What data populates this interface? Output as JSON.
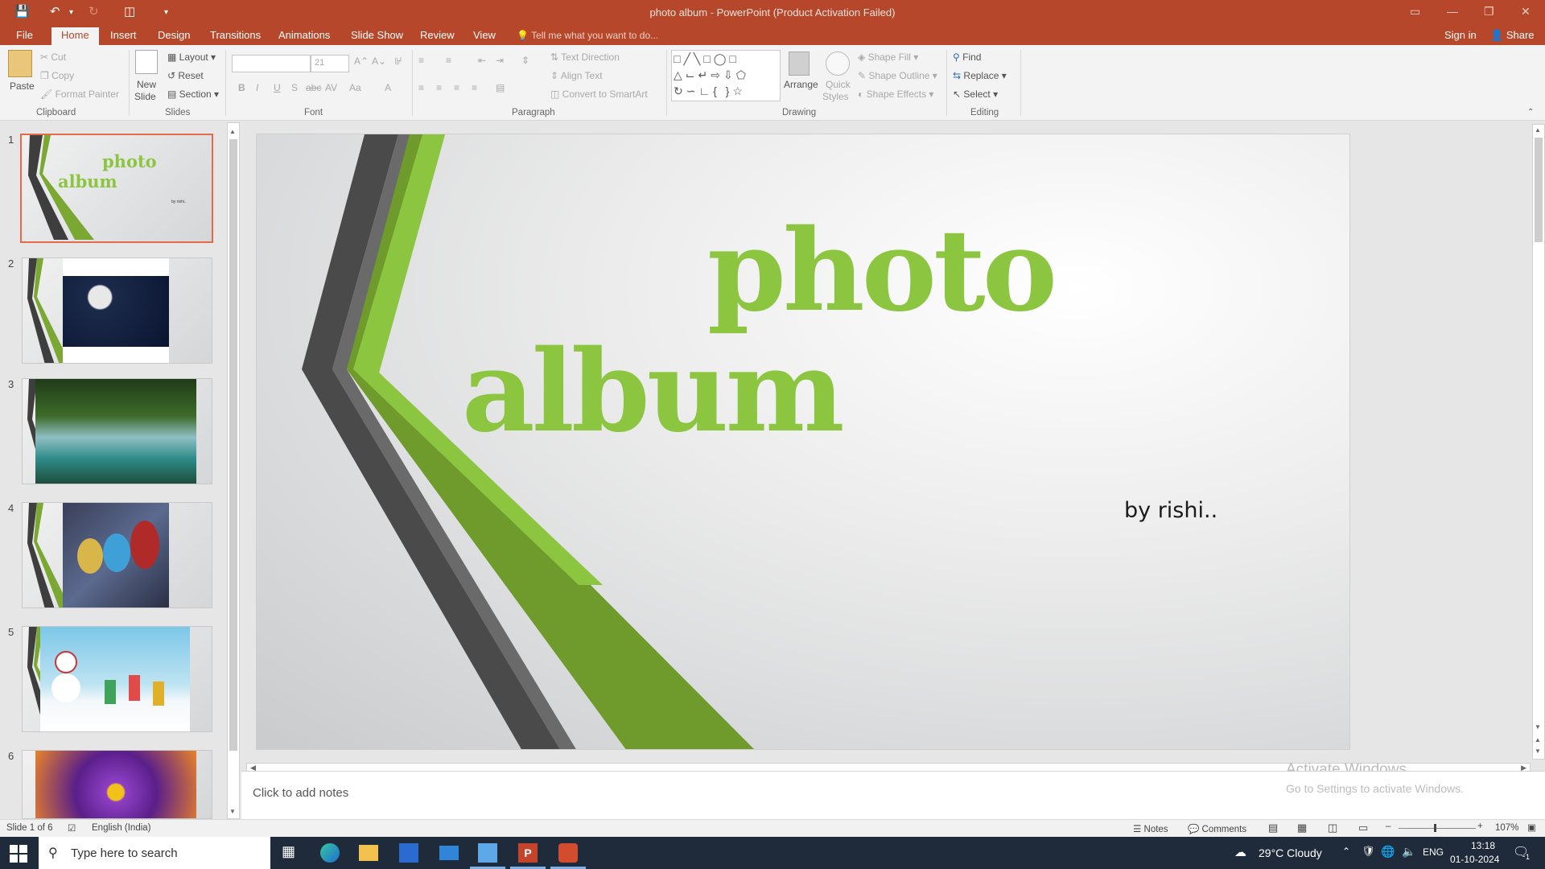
{
  "window": {
    "title": "photo album - PowerPoint (Product Activation Failed)"
  },
  "tabs": [
    "File",
    "Home",
    "Insert",
    "Design",
    "Transitions",
    "Animations",
    "Slide Show",
    "Review",
    "View"
  ],
  "tellme": "Tell me what you want to do...",
  "signin": "Sign in",
  "share": "Share",
  "ribbon": {
    "clipboard": {
      "paste": "Paste",
      "cut": "Cut",
      "copy": "Copy",
      "format_painter": "Format Painter",
      "label": "Clipboard"
    },
    "slides": {
      "new_slide_1": "New",
      "new_slide_2": "Slide",
      "layout": "Layout",
      "reset": "Reset",
      "section": "Section",
      "label": "Slides"
    },
    "font": {
      "size": "21",
      "label": "Font"
    },
    "paragraph": {
      "text_direction": "Text Direction",
      "align_text": "Align Text",
      "convert_smartart": "Convert to SmartArt",
      "label": "Paragraph"
    },
    "drawing": {
      "arrange": "Arrange",
      "quick_styles_1": "Quick",
      "quick_styles_2": "Styles",
      "shape_fill": "Shape Fill",
      "shape_outline": "Shape Outline",
      "shape_effects": "Shape Effects",
      "label": "Drawing"
    },
    "editing": {
      "find": "Find",
      "replace": "Replace",
      "select": "Select",
      "label": "Editing"
    }
  },
  "thumbnails": [
    {
      "num": "1",
      "title_1": "photo",
      "title_2": "album",
      "sub": "by rishi.."
    },
    {
      "num": "2"
    },
    {
      "num": "3"
    },
    {
      "num": "4"
    },
    {
      "num": "5"
    },
    {
      "num": "6"
    }
  ],
  "slide": {
    "title_1": "photo",
    "title_2": "album",
    "subtitle": "by rishi.."
  },
  "notes_placeholder": "Click to add notes",
  "watermark": {
    "line1": "Activate Windows",
    "line2": "Go to Settings to activate Windows."
  },
  "status": {
    "slide_of": "Slide 1 of 6",
    "language": "English (India)",
    "notes": "Notes",
    "comments": "Comments",
    "zoom": "107%"
  },
  "taskbar": {
    "search_placeholder": "Type here to search",
    "weather": "29°C  Cloudy",
    "lang": "ENG",
    "time": "13:18",
    "date": "01-10-2024",
    "notif_count": "1"
  },
  "colors": {
    "accent": "#b7472a",
    "green": "#8cc641",
    "dark_green": "#5e8a24",
    "dark_gray": "#3e3e3e"
  }
}
